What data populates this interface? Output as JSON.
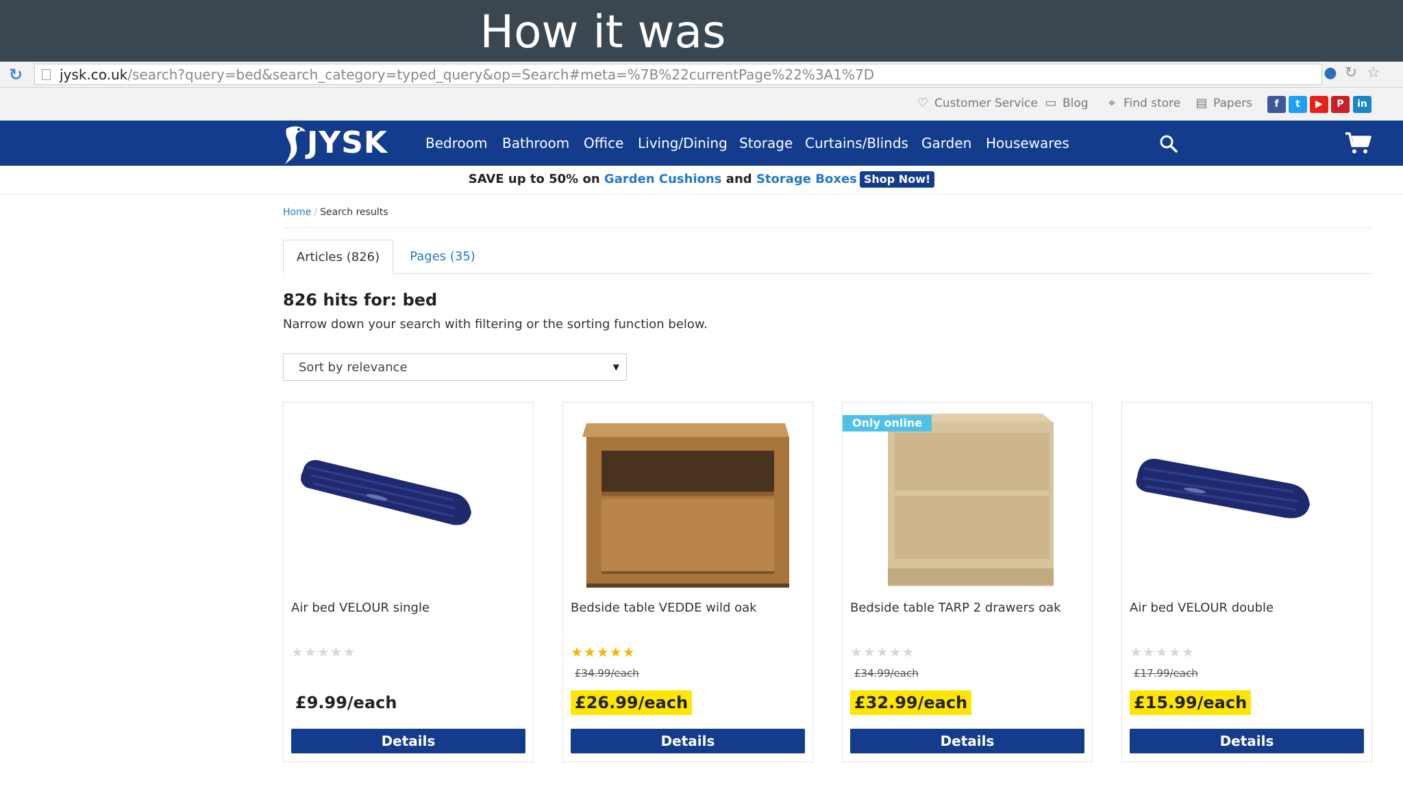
{
  "slide": {
    "title": "How it was"
  },
  "browser": {
    "url_domain": "jysk.co.uk",
    "url_rest": "/search?query=bed&search_category=typed_query&op=Search#meta=%7B%22currentPage%22%3A1%7D"
  },
  "utility": {
    "customer_service": "Customer Service",
    "blog": "Blog",
    "find_store": "Find store",
    "papers": "Papers",
    "social": [
      "f",
      "t",
      "▶",
      "P",
      "in"
    ]
  },
  "nav": {
    "logo": "JYSK",
    "items": [
      "Bedroom",
      "Bathroom",
      "Office",
      "Living/Dining",
      "Storage",
      "Curtains/Blinds",
      "Garden",
      "Housewares"
    ]
  },
  "promo": {
    "prefix": "SAVE up to 50% on",
    "link1": "Garden Cushions",
    "and": "and",
    "link2": "Storage Boxes",
    "cta": "Shop Now!"
  },
  "breadcrumb": {
    "home": "Home",
    "current": "Search results"
  },
  "tabs": {
    "articles": "Articles (826)",
    "pages": "Pages (35)"
  },
  "results": {
    "hits": "826 hits for: bed",
    "narrow": "Narrow down your search with filtering or the sorting function below."
  },
  "sort": {
    "selected": "Sort by relevance"
  },
  "products": [
    {
      "name": "Air bed VELOUR single",
      "rating": 0,
      "old_price": "",
      "price": "£9.99/each",
      "badge": "",
      "details": "Details"
    },
    {
      "name": "Bedside table VEDDE wild oak",
      "rating": 5,
      "old_price": "£34.99/each",
      "price": "£26.99/each",
      "badge": "",
      "details": "Details"
    },
    {
      "name": "Bedside table TARP 2 drawers oak",
      "rating": 0,
      "old_price": "£34.99/each",
      "price": "£32.99/each",
      "badge": "Only online",
      "details": "Details"
    },
    {
      "name": "Air bed VELOUR double",
      "rating": 0,
      "old_price": "£17.99/each",
      "price": "£15.99/each",
      "badge": "",
      "details": "Details"
    }
  ],
  "colors": {
    "nav_blue": "#143c8c",
    "link_blue": "#1e78c8",
    "sale_yellow": "#ffe600",
    "badge_cyan": "#4fc1e9",
    "star_gold": "#f5b800"
  }
}
